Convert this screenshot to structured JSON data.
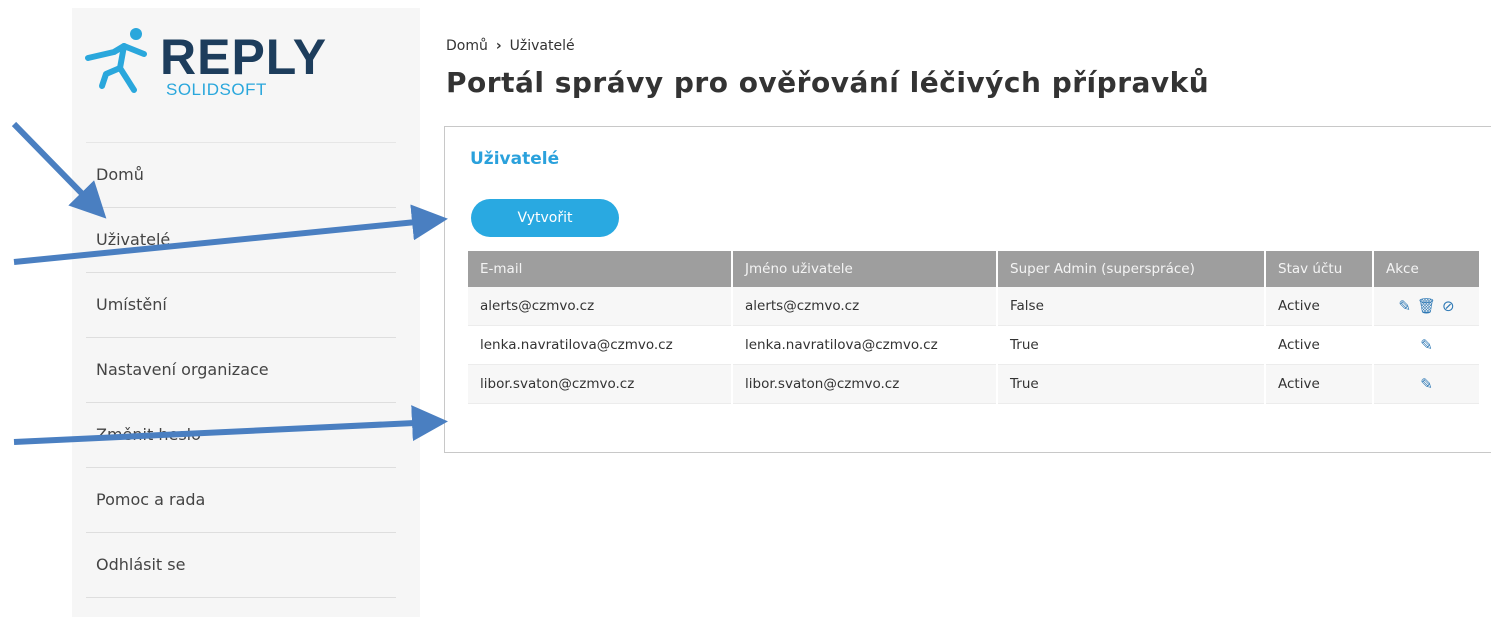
{
  "logo": {
    "name": "REPLY",
    "sub": "SOLIDSOFT"
  },
  "nav": [
    "Domů",
    "Uživatelé",
    "Umístění",
    "Nastavení organizace",
    "Změnit heslo",
    "Pomoc a rada",
    "Odhlásit se"
  ],
  "breadcrumb": {
    "home": "Domů",
    "separator": "›",
    "current": "Uživatelé"
  },
  "page_title": "Portál správy pro ověřování léčivých přípravků",
  "panel": {
    "title": "Uživatelé",
    "create_label": "Vytvořit"
  },
  "table": {
    "headers": [
      "E-mail",
      "Jméno uživatele",
      "Super Admin (superspráce)",
      "Stav účtu",
      "Akce"
    ],
    "rows": [
      {
        "email": "alerts@czmvo.cz",
        "username": "alerts@czmvo.cz",
        "super_admin": "False",
        "status": "Active",
        "actions": [
          "edit-icon",
          "trash-icon",
          "disable-icon"
        ]
      },
      {
        "email": "lenka.navratilova@czmvo.cz",
        "username": "lenka.navratilova@czmvo.cz",
        "super_admin": "True",
        "status": "Active",
        "actions": [
          "edit-icon"
        ]
      },
      {
        "email": "libor.svaton@czmvo.cz",
        "username": "libor.svaton@czmvo.cz",
        "super_admin": "True",
        "status": "Active",
        "actions": [
          "edit-icon"
        ]
      }
    ]
  },
  "colors": {
    "accent": "#29a9e1",
    "header_bg": "#9e9e9e",
    "logo_text": "#1d3d5c",
    "arrow": "#4a7fc1"
  }
}
